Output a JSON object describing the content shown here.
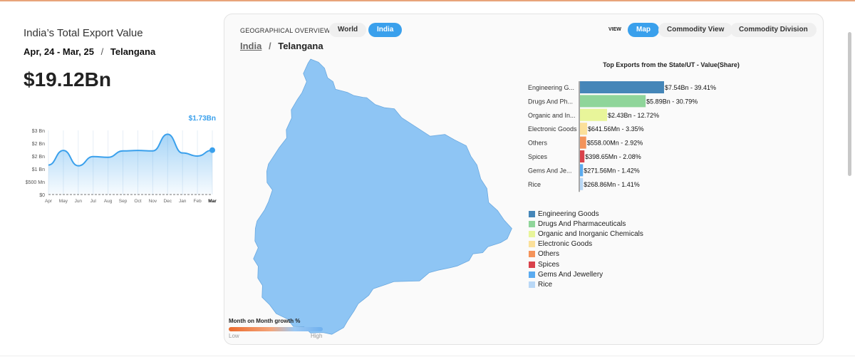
{
  "summary": {
    "title": "India’s Total Export Value",
    "period": "Apr, 24 - Mar, 25",
    "period_separator": "/",
    "region": "Telangana",
    "total": "$19.12Bn"
  },
  "trend": {
    "callout": "$1.73Bn",
    "y_ticks": [
      "$0",
      "$500 Mn",
      "$1 Bn",
      "$2 Bn",
      "$2 Bn",
      "$3 Bn"
    ],
    "y_values": [
      0,
      0.5,
      1,
      1.5,
      2,
      2.5
    ],
    "months": [
      "Apr",
      "May",
      "Jun",
      "Jul",
      "Aug",
      "Sep",
      "Oct",
      "Nov",
      "Dec",
      "Jan",
      "Feb",
      "Mar"
    ],
    "values": [
      1.15,
      1.72,
      1.12,
      1.48,
      1.45,
      1.7,
      1.72,
      1.7,
      2.35,
      1.62,
      1.5,
      1.73
    ],
    "ylim": [
      0,
      2.5
    ],
    "highlight_month": "Mar",
    "line_color": "#3aa0ec"
  },
  "tabs": {
    "geo_label": "GEOGRAPHICAL OVERVIEW",
    "world": "World",
    "india": "India",
    "view_label": "VIEW",
    "map": "Map",
    "commodity_view": "Commodity View",
    "commodity_division": "Commodity Division"
  },
  "breadcrumb": {
    "root": "India",
    "separator": "/",
    "current": "Telangana"
  },
  "map": {
    "fill": "#8ec5f4",
    "stroke": "#6aa9e0"
  },
  "growth_legend": {
    "label": "Month on Month growth %",
    "low": "Low",
    "high": "High"
  },
  "chart_data": {
    "type": "bar",
    "title": "Top Exports from the State/UT - Value(Share)",
    "categories": [
      "Engineering G...",
      "Drugs And Ph...",
      "Organic and In...",
      "Electronic Goods",
      "Others",
      "Spices",
      "Gems And Je...",
      "Rice"
    ],
    "values_usd_bn": [
      7.54,
      5.89,
      2.43,
      0.64156,
      0.558,
      0.39865,
      0.27156,
      0.26886
    ],
    "labels": [
      "$7.54Bn - 39.41%",
      "$5.89Bn - 30.79%",
      "$2.43Bn - 12.72%",
      "$641.56Mn - 3.35%",
      "$558.00Mn - 2.92%",
      "$398.65Mn - 2.08%",
      "$271.56Mn - 1.42%",
      "$268.86Mn - 1.41%"
    ],
    "share_percent": [
      39.41,
      30.79,
      12.72,
      3.35,
      2.92,
      2.08,
      1.42,
      1.41
    ],
    "colors": [
      "#4586b8",
      "#8fd59a",
      "#e8f59a",
      "#fbe09a",
      "#f4935a",
      "#d9424b",
      "#5aabf0",
      "#b9d8f6"
    ],
    "legend": [
      "Engineering Goods",
      "Drugs And Pharmaceuticals",
      "Organic and Inorganic Chemicals",
      "Electronic Goods",
      "Others",
      "Spices",
      "Gems And Jewellery",
      "Rice"
    ],
    "legend_position": "bottom-left"
  }
}
